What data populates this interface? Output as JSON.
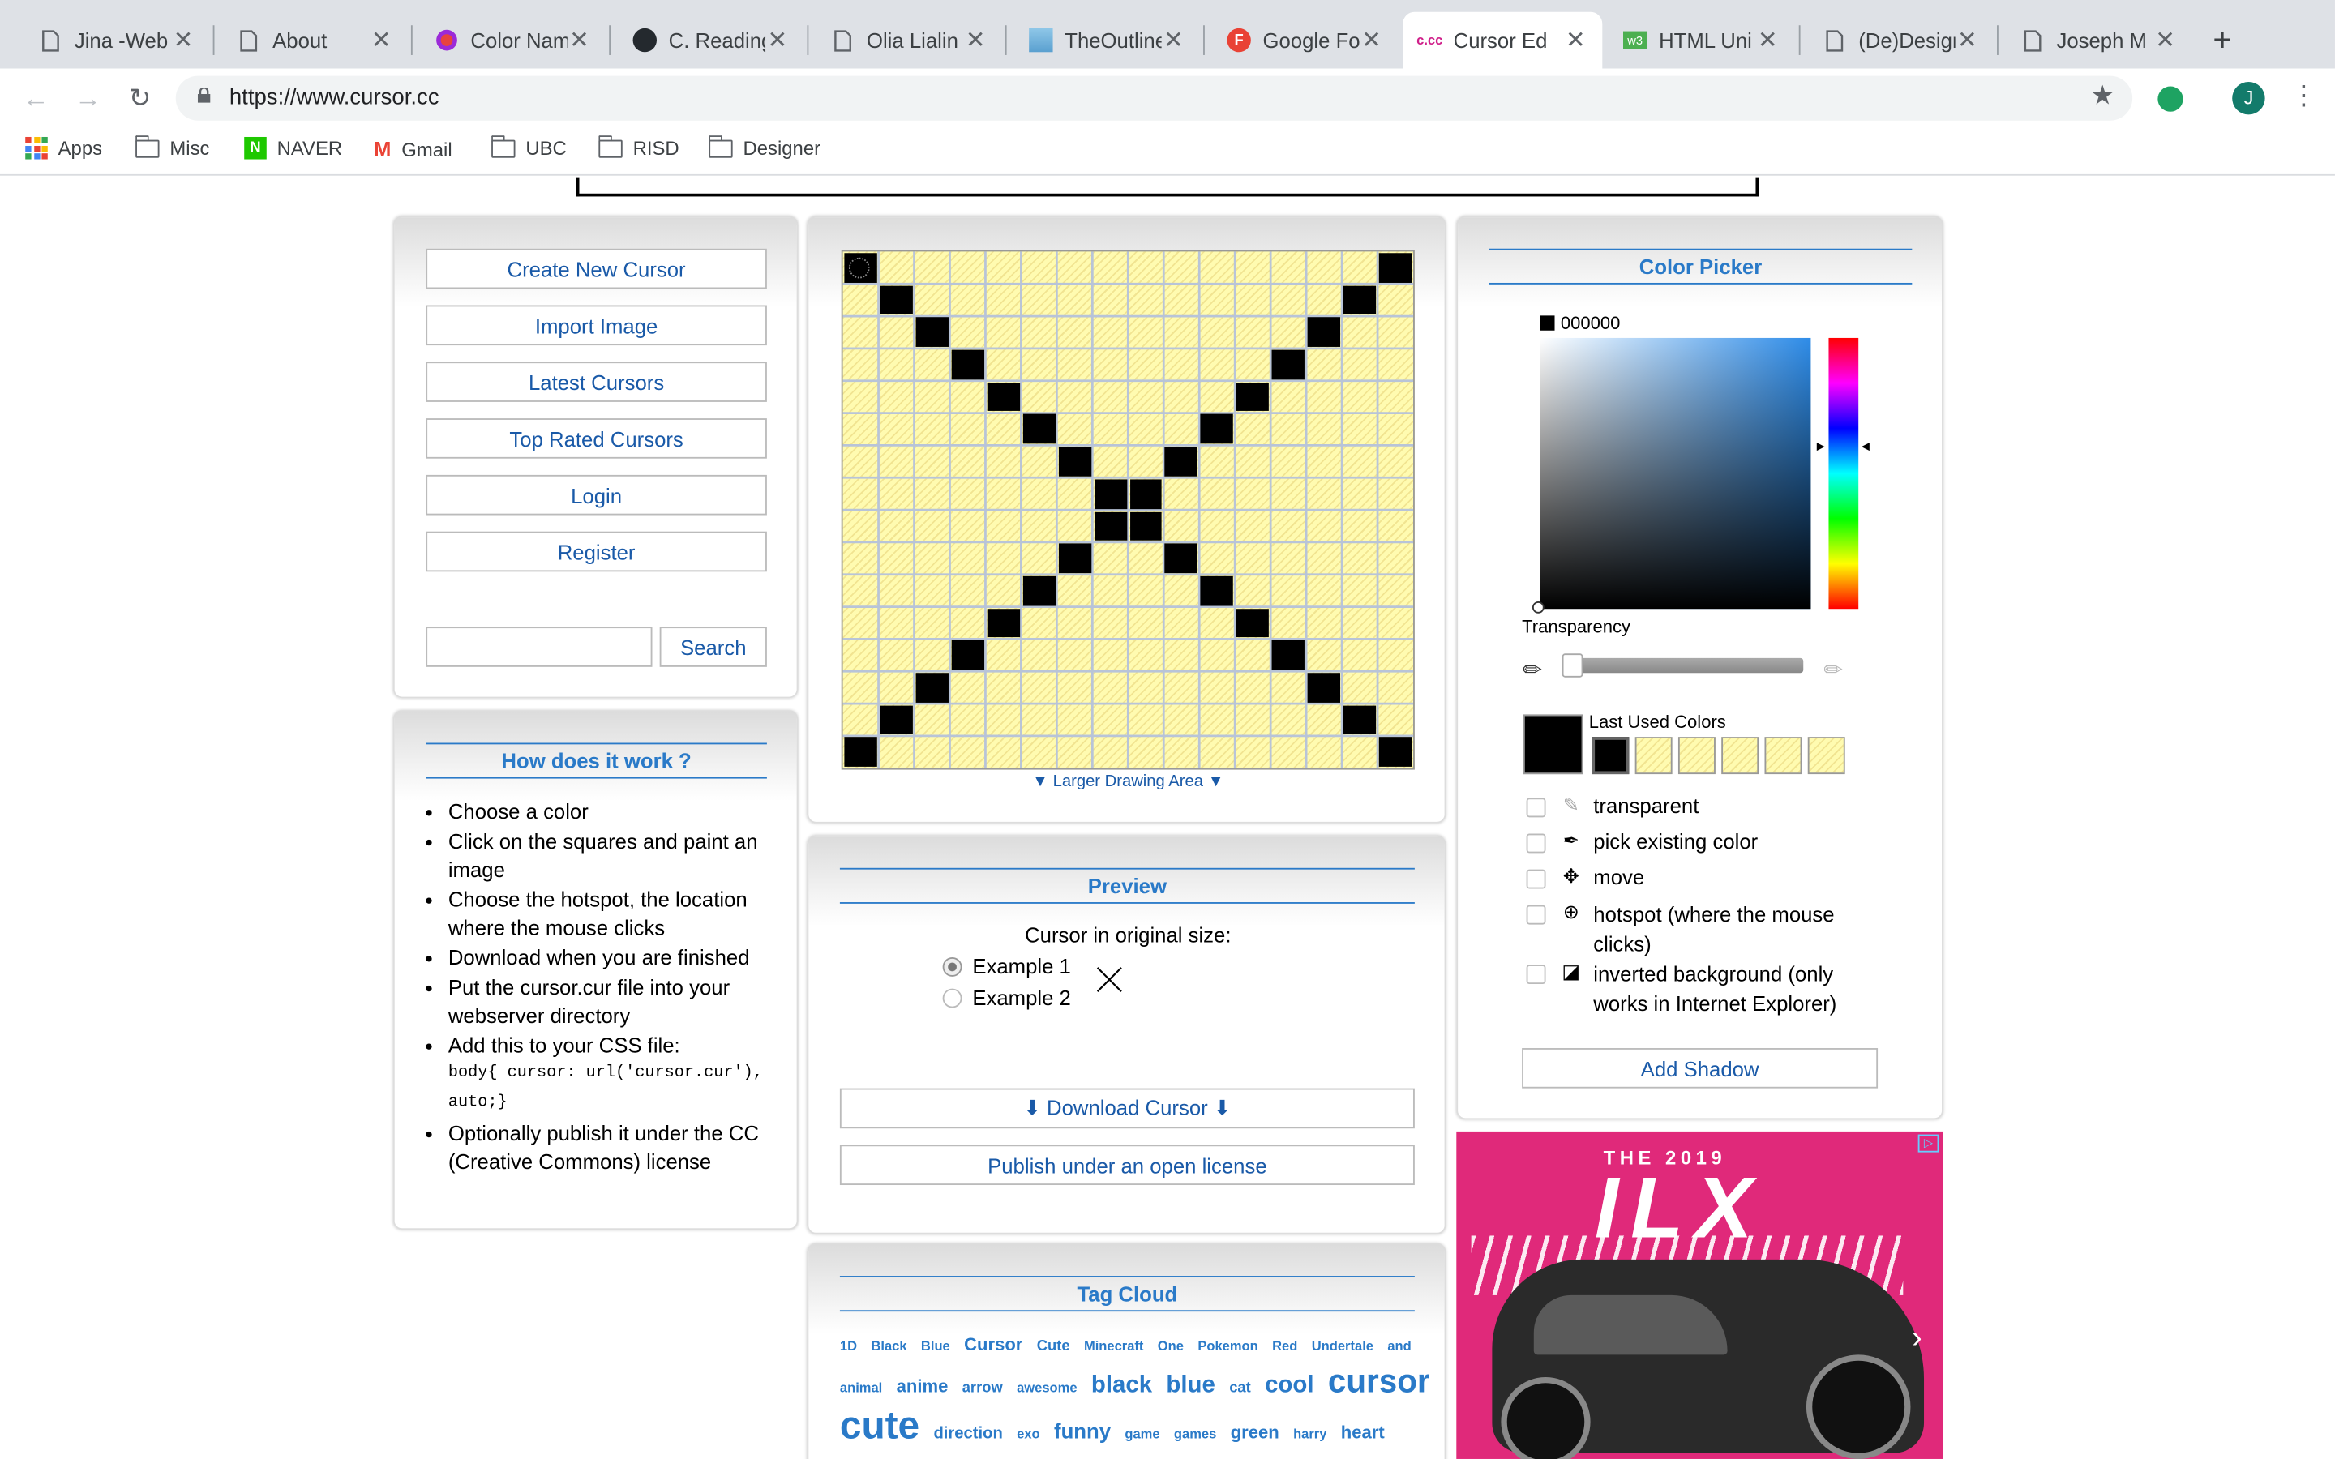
{
  "browser": {
    "tabs": [
      {
        "title": "Jina -Web",
        "icon": "page-icon"
      },
      {
        "title": "About",
        "icon": "page-icon"
      },
      {
        "title": "Color Nam",
        "icon": "colorname-icon"
      },
      {
        "title": "C. Reading",
        "icon": "github-icon"
      },
      {
        "title": "Olia Lialin",
        "icon": "page-icon"
      },
      {
        "title": "TheOutline",
        "icon": "outline-icon"
      },
      {
        "title": "Google Fo",
        "icon": "google-fonts-icon"
      },
      {
        "title": "Cursor Ed",
        "icon": "cursor-cc-icon",
        "active": true
      },
      {
        "title": "HTML Uni",
        "icon": "w3-icon"
      },
      {
        "title": "(De)Design",
        "icon": "page-icon"
      },
      {
        "title": "Joseph M",
        "icon": "page-icon"
      }
    ],
    "url": "https://www.cursor.cc",
    "bookmarks": [
      "Apps",
      "Misc",
      "NAVER",
      "Gmail",
      "UBC",
      "RISD",
      "Designer"
    ],
    "profile_initial": "J"
  },
  "menu": {
    "create": "Create New Cursor",
    "import": "Import Image",
    "latest": "Latest Cursors",
    "top_rated": "Top Rated Cursors",
    "login": "Login",
    "register": "Register",
    "search_placeholder": "",
    "search_button": "Search"
  },
  "how": {
    "title": "How does it work ?",
    "steps": [
      "Choose a color",
      "Click on the squares and paint an image",
      "Choose the hotspot, the location where the mouse clicks",
      "Download when you are finished",
      "Put the cursor.cur file into your webserver directory",
      "Add this to your CSS file:",
      "Optionally publish it under the CC (Creative Commons) license"
    ],
    "code": "body{ cursor: url('cursor.cur'), auto;}"
  },
  "drawing": {
    "larger_area": "Larger Drawing Area",
    "grid_size": 16,
    "filled": [
      [
        0,
        0
      ],
      [
        15,
        0
      ],
      [
        1,
        1
      ],
      [
        14,
        1
      ],
      [
        2,
        2
      ],
      [
        13,
        2
      ],
      [
        3,
        3
      ],
      [
        12,
        3
      ],
      [
        4,
        4
      ],
      [
        11,
        4
      ],
      [
        5,
        5
      ],
      [
        10,
        5
      ],
      [
        6,
        6
      ],
      [
        9,
        6
      ],
      [
        7,
        7
      ],
      [
        8,
        7
      ],
      [
        7,
        8
      ],
      [
        8,
        8
      ],
      [
        6,
        9
      ],
      [
        9,
        9
      ],
      [
        5,
        10
      ],
      [
        10,
        10
      ],
      [
        4,
        11
      ],
      [
        11,
        11
      ],
      [
        3,
        12
      ],
      [
        12,
        12
      ],
      [
        2,
        13
      ],
      [
        13,
        13
      ],
      [
        1,
        14
      ],
      [
        14,
        14
      ],
      [
        0,
        15
      ],
      [
        15,
        15
      ]
    ]
  },
  "preview": {
    "title": "Preview",
    "subtitle": "Cursor in original size:",
    "example1": "Example 1",
    "example2": "Example 2",
    "download": "⬇ Download Cursor ⬇",
    "publish": "Publish under an open license"
  },
  "tags": {
    "title": "Tag Cloud",
    "row1": [
      "1D",
      "Black",
      "Blue",
      "Cursor",
      "Cute",
      "Minecraft",
      "One",
      "Pokemon",
      "Red",
      "Undertale",
      "and"
    ],
    "row2": [
      "animal",
      "anime",
      "arrow",
      "awesome",
      "black",
      "blue",
      "cat",
      "cool",
      "cursor"
    ],
    "row3": [
      "cute",
      "direction",
      "exo",
      "funny",
      "game",
      "games",
      "green",
      "harry",
      "heart"
    ]
  },
  "picker": {
    "title": "Color Picker",
    "hex": "000000",
    "transparency": "Transparency",
    "last_used": "Last Used Colors",
    "options": [
      "transparent",
      "pick existing color",
      "move",
      "hotspot (where the mouse clicks)",
      "inverted background (only works in Internet Explorer)"
    ],
    "add_shadow": "Add Shadow",
    "current_color": "#000000",
    "accent": "#2a7ac8"
  },
  "ad": {
    "headline": "THE 2019",
    "model": "ILX"
  }
}
